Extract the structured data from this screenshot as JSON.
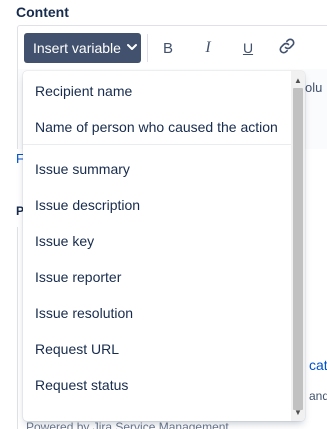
{
  "section": {
    "title": "Content"
  },
  "toolbar": {
    "insert_variable_label": "Insert variable",
    "bold_label": "B",
    "italic_label": "I",
    "underline_label": "U"
  },
  "background": {
    "fragment_right_1": "olu",
    "fragment_link_f": "F",
    "fragment_p": "P",
    "fragment_right_2": "cati",
    "fragment_right_3": "and",
    "powered_by": "Powered by Jira Service Management"
  },
  "dropdown": {
    "items": [
      {
        "label": "Recipient name"
      },
      {
        "label": "Name of person who caused the action"
      },
      {
        "label": "Issue summary"
      },
      {
        "label": "Issue description"
      },
      {
        "label": "Issue key"
      },
      {
        "label": "Issue reporter"
      },
      {
        "label": "Issue resolution"
      },
      {
        "label": "Request URL"
      },
      {
        "label": "Request status"
      }
    ]
  },
  "colors": {
    "button_bg": "#42526e",
    "text": "#172b4d",
    "link": "#0052cc",
    "scroll_thumb": "#c1c1c1"
  },
  "icons": {
    "dropdown_chevron": "chevron-down-icon",
    "link_tool": "link-icon",
    "scroll_up": "scroll-up-arrow-icon",
    "scroll_down": "scroll-down-arrow-icon"
  }
}
